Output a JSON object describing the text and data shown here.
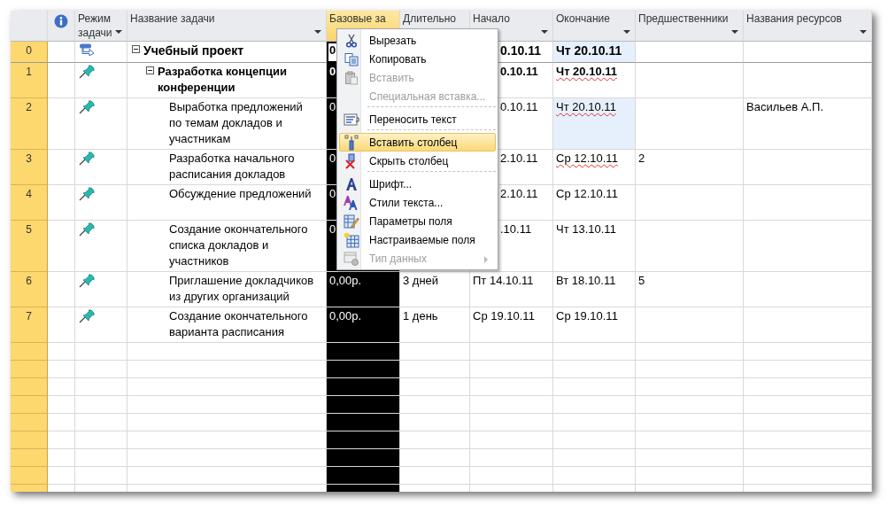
{
  "columns": [
    {
      "kind": "info",
      "selected": false
    },
    {
      "kind": "mode",
      "label": "Режим задачи",
      "selected": false
    },
    {
      "kind": "name",
      "label": "Название задачи",
      "selected": false
    },
    {
      "kind": "baseline",
      "label": "Базовые за",
      "selected": true
    },
    {
      "kind": "duration",
      "label": "Длительно",
      "selected": false
    },
    {
      "kind": "start",
      "label": "Начало",
      "selected": false
    },
    {
      "kind": "finish",
      "label": "Окончание",
      "selected": false
    },
    {
      "kind": "predecessors",
      "label": "Предшественники",
      "selected": false
    },
    {
      "kind": "resources",
      "label": "Названия ресурсов",
      "selected": false
    }
  ],
  "tasks": [
    {
      "id": "0",
      "kind": "auto",
      "name": "Учебный проект",
      "expanded": true,
      "baseline": "0",
      "active": true,
      "start": "0.10.11",
      "finish": "Чт 20.10.11",
      "highlighted": true,
      "misspelled": false,
      "children": [
        {
          "id": "1",
          "kind": "manual",
          "name": "Разработка концепции конференции",
          "expanded": true,
          "baseline": "0",
          "active": false,
          "start": "0.10.11",
          "finish": "Чт 20.10.11",
          "highlighted": false,
          "misspelled": true,
          "children": [
            {
              "id": "2",
              "kind": "manual",
              "name": "Выработка предложений по темам докладов и участникам",
              "baseline": "0",
              "active": false,
              "start": "0.10.11",
              "finish": "Чт 20.10.11",
              "highlighted": true,
              "misspelled": true,
              "resources": "Васильев А.П."
            },
            {
              "id": "3",
              "kind": "manual",
              "name": "Разработка начального расписания докладов",
              "baseline": "0",
              "active": false,
              "start": "2.10.11",
              "finish": "Ср 12.10.11",
              "highlighted": false,
              "misspelled": true,
              "predecessors": "2"
            },
            {
              "id": "4",
              "kind": "manual",
              "name": "Обсуждение предложений",
              "baseline": "0",
              "active": false,
              "start": "2.10.11",
              "finish": "Ср 12.10.11",
              "highlighted": false,
              "misspelled": false
            },
            {
              "id": "5",
              "kind": "manual",
              "name": "Создание окончательного списка докладов и участников",
              "baseline": "0",
              "active": false,
              "start": ".10.11",
              "finish": "Чт 13.10.11",
              "highlighted": false,
              "misspelled": false
            },
            {
              "id": "6",
              "kind": "manual",
              "name": "Приглашение докладчиков из других организаций",
              "baseline": "0,00р.",
              "active": false,
              "duration": "3 дней",
              "start": "Пт 14.10.11",
              "finish": "Вт 18.10.11",
              "highlighted": false,
              "misspelled": false,
              "predecessors": "5"
            },
            {
              "id": "7",
              "kind": "manual",
              "name": "Создание окончательного варианта расписания",
              "baseline": "0,00р.",
              "active": false,
              "duration": "1 день",
              "start": "Ср 19.10.11",
              "finish": "Ср 19.10.11",
              "highlighted": false,
              "misspelled": false
            }
          ]
        }
      ]
    }
  ],
  "menu": {
    "items": [
      {
        "kind": "item",
        "label": "Вырезать",
        "disabled": false,
        "selected": false,
        "submenu": false
      },
      {
        "kind": "item",
        "label": "Копировать",
        "disabled": false,
        "selected": false,
        "submenu": false
      },
      {
        "kind": "item",
        "label": "Вставить",
        "disabled": true,
        "selected": false,
        "submenu": false
      },
      {
        "kind": "item",
        "label": "Специальная вставка...",
        "disabled": true,
        "selected": false,
        "submenu": false
      },
      {
        "kind": "separator"
      },
      {
        "kind": "item",
        "label": "Переносить текст",
        "disabled": false,
        "selected": false,
        "submenu": false
      },
      {
        "kind": "separator"
      },
      {
        "kind": "item",
        "label": "Вставить столбец",
        "disabled": false,
        "selected": true,
        "submenu": false
      },
      {
        "kind": "item",
        "label": "Скрыть столбец",
        "disabled": false,
        "selected": false,
        "submenu": false
      },
      {
        "kind": "separator"
      },
      {
        "kind": "item",
        "label": "Шрифт...",
        "disabled": false,
        "selected": false,
        "submenu": false
      },
      {
        "kind": "item",
        "label": "Стили текста...",
        "disabled": false,
        "selected": false,
        "submenu": false
      },
      {
        "kind": "item",
        "label": "Параметры поля",
        "disabled": false,
        "selected": false,
        "submenu": false
      },
      {
        "kind": "item",
        "label": "Настраиваемые поля",
        "disabled": false,
        "selected": false,
        "submenu": false
      },
      {
        "kind": "item",
        "label": "Тип данных",
        "disabled": true,
        "selected": false,
        "submenu": true
      }
    ]
  }
}
